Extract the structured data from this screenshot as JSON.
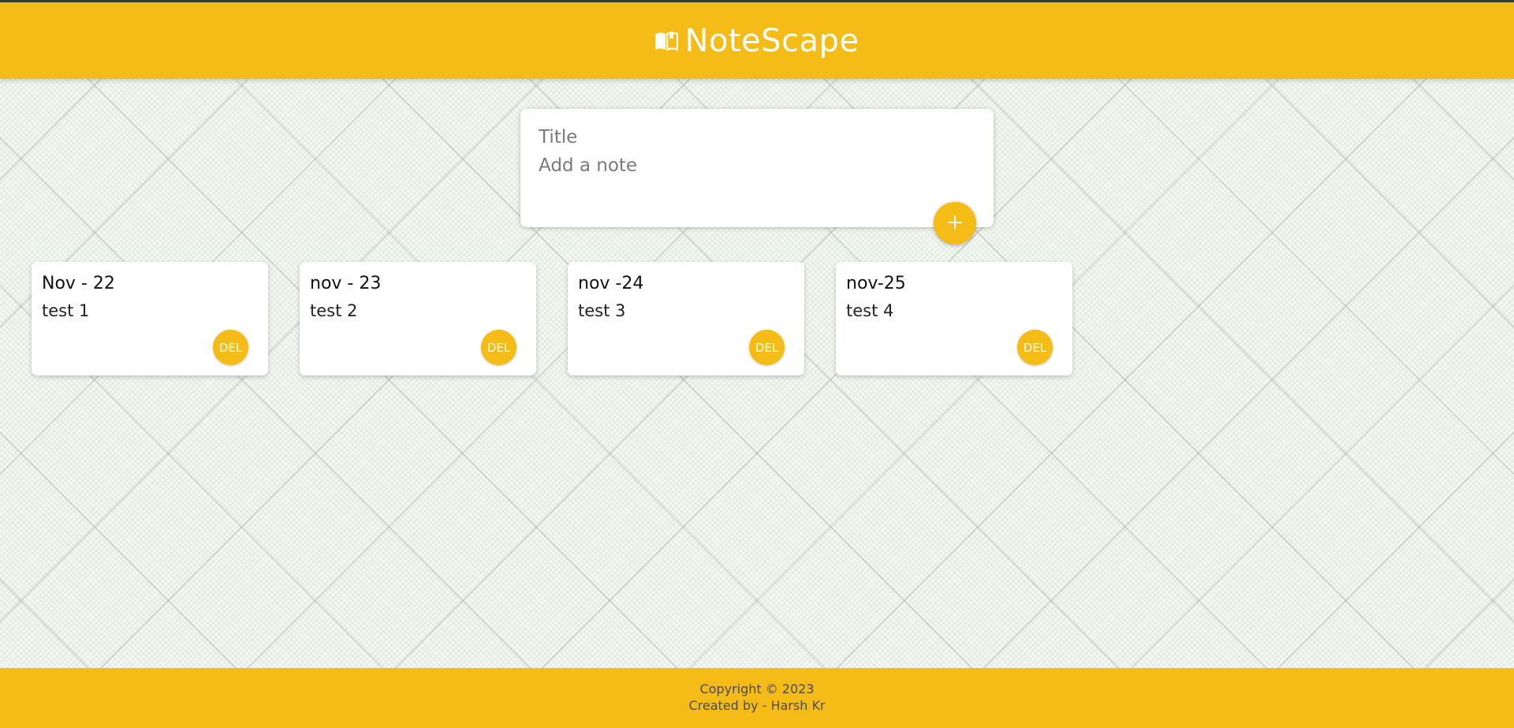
{
  "header": {
    "title": "NoteScape",
    "logo_icon": "open-book-icon",
    "background": "#f5bb16"
  },
  "composer": {
    "title_placeholder": "Title",
    "content_placeholder": "Add a note",
    "add_icon": "plus-icon"
  },
  "notes": [
    {
      "title": "Nov - 22",
      "content": "test 1",
      "delete_label": "DEL"
    },
    {
      "title": "nov - 23",
      "content": "test 2",
      "delete_label": "DEL"
    },
    {
      "title": "nov -24",
      "content": "test 3",
      "delete_label": "DEL"
    },
    {
      "title": "nov-25",
      "content": "test 4",
      "delete_label": "DEL"
    }
  ],
  "footer": {
    "copyright": "Copyright © 2023",
    "credit": "Created by - Harsh Kr"
  },
  "colors": {
    "accent": "#f5bb16",
    "card": "#ffffff",
    "footer_text": "#4a4a4a"
  }
}
